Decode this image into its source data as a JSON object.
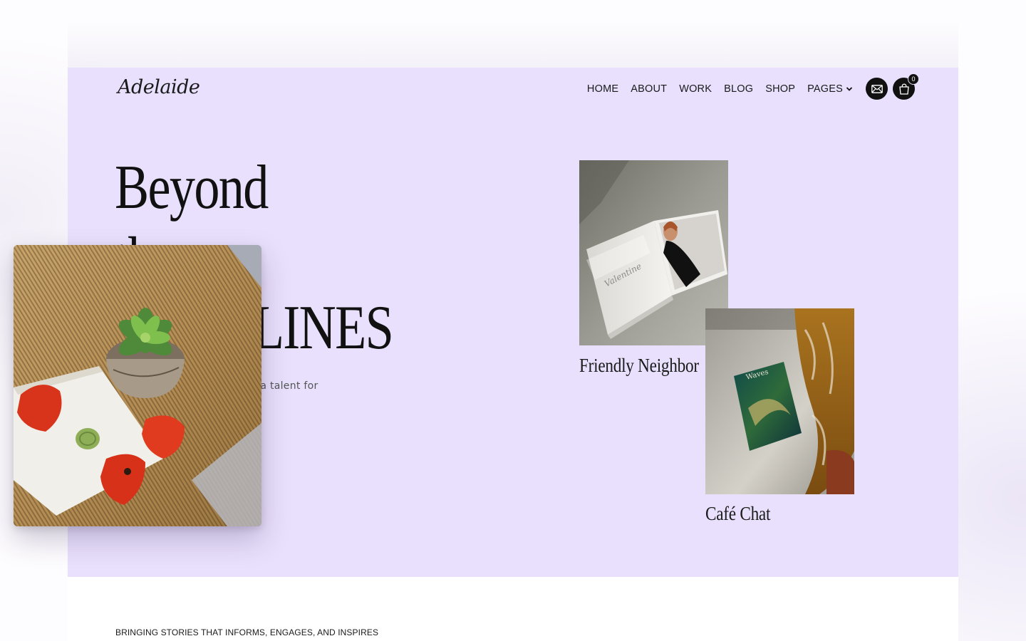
{
  "site": {
    "logo": "Adelaide"
  },
  "nav": {
    "items": [
      "HOME",
      "ABOUT",
      "WORK",
      "BLOG",
      "SHOP"
    ],
    "pages_label": "PAGES",
    "cart_count": "0",
    "icons": {
      "mail": "mail-icon",
      "cart": "cart-icon",
      "chevron": "chevron-down-icon"
    }
  },
  "hero": {
    "headline_line1": "Beyond",
    "headline_line2": "the",
    "headline_line3": "HEADLINES",
    "description": "Passion for storytelling and a talent for"
  },
  "cards": [
    {
      "caption": "Friendly Neighbor",
      "image": "magazine-valentine"
    },
    {
      "caption": "Café Chat",
      "image": "magazine-waves-on-chair"
    }
  ],
  "section2": {
    "tagline": "BRINGING STORIES THAT INFORMS, ENGAGES, AND INSPIRES"
  },
  "colors": {
    "hero_bg": "#e8e0fc",
    "text": "#111111",
    "icon_button": "#111111"
  }
}
